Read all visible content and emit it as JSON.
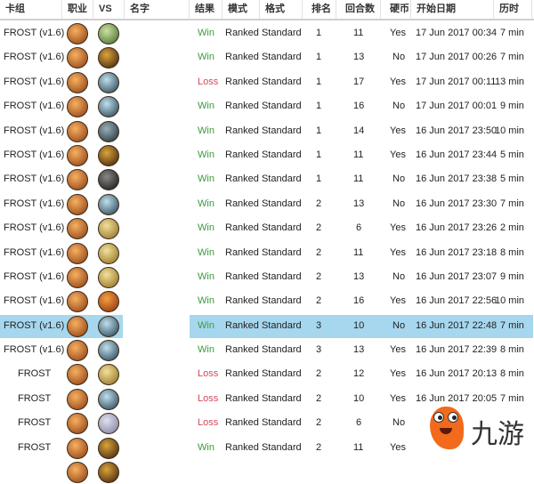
{
  "columns": [
    "卡组",
    "职业",
    "VS",
    "名字",
    "结果",
    "模式",
    "格式",
    "排名",
    "回合数",
    "硬币",
    "开始日期",
    "历时"
  ],
  "colors": {
    "win": "#3c9a3c",
    "loss": "#d0495a",
    "selected_row": "#a6d7ee"
  },
  "class_icon": "mage-icon",
  "rows": [
    {
      "deck": "FROST (v1.6)",
      "vs": "druid",
      "result": "Win",
      "mode": "Ranked Standard",
      "rank": "1",
      "turns": "11",
      "coin": "Yes",
      "date": "17 Jun 2017 00:34",
      "duration": "7 min"
    },
    {
      "deck": "FROST (v1.6)",
      "vs": "warrior",
      "result": "Win",
      "mode": "Ranked Standard",
      "rank": "1",
      "turns": "13",
      "coin": "No",
      "date": "17 Jun 2017 00:26",
      "duration": "7 min"
    },
    {
      "deck": "FROST (v1.6)",
      "vs": "shaman",
      "result": "Loss",
      "mode": "Ranked Standard",
      "rank": "1",
      "turns": "17",
      "coin": "Yes",
      "date": "17 Jun 2017 00:11",
      "duration": "13 min"
    },
    {
      "deck": "FROST (v1.6)",
      "vs": "shaman",
      "result": "Win",
      "mode": "Ranked Standard",
      "rank": "1",
      "turns": "16",
      "coin": "No",
      "date": "17 Jun 2017 00:01",
      "duration": "9 min"
    },
    {
      "deck": "FROST (v1.6)",
      "vs": "hunter",
      "result": "Win",
      "mode": "Ranked Standard",
      "rank": "1",
      "turns": "14",
      "coin": "Yes",
      "date": "16 Jun 2017 23:50",
      "duration": "10 min"
    },
    {
      "deck": "FROST (v1.6)",
      "vs": "warrior",
      "result": "Win",
      "mode": "Ranked Standard",
      "rank": "1",
      "turns": "11",
      "coin": "Yes",
      "date": "16 Jun 2017 23:44",
      "duration": "5 min"
    },
    {
      "deck": "FROST (v1.6)",
      "vs": "rogue",
      "result": "Win",
      "mode": "Ranked Standard",
      "rank": "1",
      "turns": "11",
      "coin": "No",
      "date": "16 Jun 2017 23:38",
      "duration": "5 min"
    },
    {
      "deck": "FROST (v1.6)",
      "vs": "shaman",
      "result": "Win",
      "mode": "Ranked Standard",
      "rank": "2",
      "turns": "13",
      "coin": "No",
      "date": "16 Jun 2017 23:30",
      "duration": "7 min"
    },
    {
      "deck": "FROST (v1.6)",
      "vs": "paladin",
      "result": "Win",
      "mode": "Ranked Standard",
      "rank": "2",
      "turns": "6",
      "coin": "Yes",
      "date": "16 Jun 2017 23:26",
      "duration": "2 min"
    },
    {
      "deck": "FROST (v1.6)",
      "vs": "paladin",
      "result": "Win",
      "mode": "Ranked Standard",
      "rank": "2",
      "turns": "11",
      "coin": "Yes",
      "date": "16 Jun 2017 23:18",
      "duration": "8 min"
    },
    {
      "deck": "FROST (v1.6)",
      "vs": "paladin",
      "result": "Win",
      "mode": "Ranked Standard",
      "rank": "2",
      "turns": "13",
      "coin": "No",
      "date": "16 Jun 2017 23:07",
      "duration": "9 min"
    },
    {
      "deck": "FROST (v1.6)",
      "vs": "mage",
      "result": "Win",
      "mode": "Ranked Standard",
      "rank": "2",
      "turns": "16",
      "coin": "Yes",
      "date": "16 Jun 2017 22:56",
      "duration": "10 min"
    },
    {
      "deck": "FROST (v1.6)",
      "vs": "shaman",
      "result": "Win",
      "mode": "Ranked Standard",
      "rank": "3",
      "turns": "10",
      "coin": "No",
      "date": "16 Jun 2017 22:48",
      "duration": "7 min",
      "selected": true
    },
    {
      "deck": "FROST (v1.6)",
      "vs": "shaman",
      "result": "Win",
      "mode": "Ranked Standard",
      "rank": "3",
      "turns": "13",
      "coin": "Yes",
      "date": "16 Jun 2017 22:39",
      "duration": "8 min"
    },
    {
      "deck": "FROST",
      "vs": "paladin",
      "result": "Loss",
      "mode": "Ranked Standard",
      "rank": "2",
      "turns": "12",
      "coin": "Yes",
      "date": "16 Jun 2017 20:13",
      "duration": "8 min"
    },
    {
      "deck": "FROST",
      "vs": "shaman",
      "result": "Loss",
      "mode": "Ranked Standard",
      "rank": "2",
      "turns": "10",
      "coin": "Yes",
      "date": "16 Jun 2017 20:05",
      "duration": "7 min"
    },
    {
      "deck": "FROST",
      "vs": "priest",
      "result": "Loss",
      "mode": "Ranked Standard",
      "rank": "2",
      "turns": "6",
      "coin": "No",
      "date": "",
      "duration": ""
    },
    {
      "deck": "FROST",
      "vs": "warrior",
      "result": "Win",
      "mode": "Ranked Standard",
      "rank": "2",
      "turns": "11",
      "coin": "Yes",
      "date": "",
      "duration": ""
    }
  ],
  "watermark": {
    "text": "九游"
  }
}
